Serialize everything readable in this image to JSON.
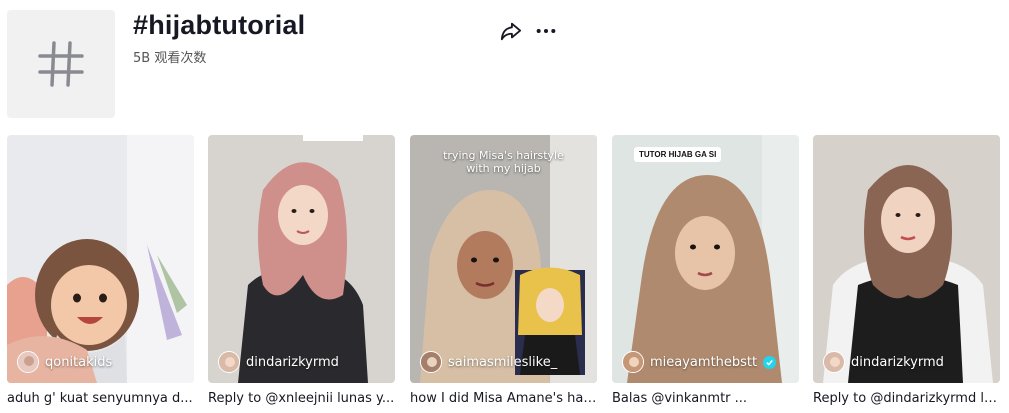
{
  "header": {
    "title": "#hijabtutorial",
    "views": "5B 观看次数",
    "share_icon": "share-icon",
    "more_icon": "more-icon"
  },
  "videos": [
    {
      "author": "qonitakids",
      "caption": "aduh g' kuat senyumnya d...",
      "overlay": "",
      "verified": false
    },
    {
      "author": "dindarizkyrmd",
      "caption": "Reply to @xnleejnii lunas y...",
      "overlay": "",
      "verified": false
    },
    {
      "author": "saimasmileslike_",
      "caption": "how I did Misa Amane's hai...",
      "overlay": "trying Misa's hairstyle with my hijab",
      "verified": false
    },
    {
      "author": "mieayamthebstt",
      "caption": "Balas @vinkanmtr ...",
      "overlay": "TUTOR HIJAB GA SI",
      "verified": true
    },
    {
      "author": "dindarizkyrmd",
      "caption": "Reply to @dindarizkyrmd lu...",
      "overlay": "",
      "verified": false
    }
  ],
  "colors": {
    "tile_bg": "#f1f1f2",
    "verified": "#20d5ec",
    "text": "#161823"
  }
}
